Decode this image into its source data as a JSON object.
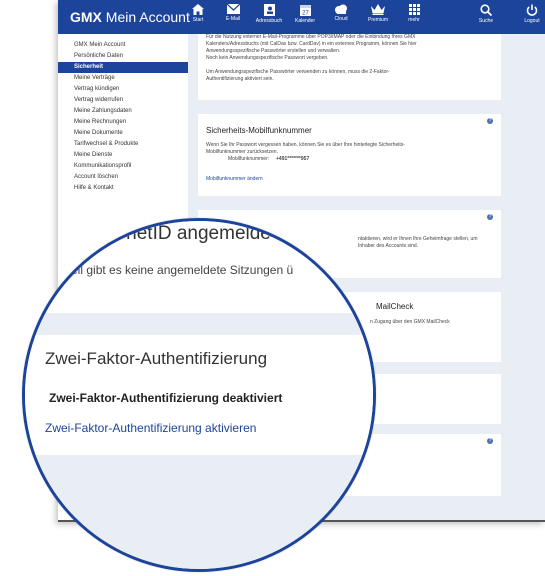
{
  "header": {
    "logo_brand": "GMX",
    "logo_title": "Mein Account",
    "nav": [
      {
        "label": "Start",
        "icon": "home-icon"
      },
      {
        "label": "E-Mail",
        "icon": "mail-icon"
      },
      {
        "label": "Adressbuch",
        "icon": "address-book-icon"
      },
      {
        "label": "Kalender",
        "icon": "calendar-icon"
      },
      {
        "label": "Cloud",
        "icon": "cloud-icon"
      },
      {
        "label": "Premium",
        "icon": "crown-icon"
      },
      {
        "label": "mehr",
        "icon": "grid-icon"
      },
      {
        "label": "Suche",
        "icon": "search-icon"
      },
      {
        "label": "Logout",
        "icon": "power-icon"
      }
    ]
  },
  "sidebar": {
    "items": [
      {
        "label": "GMX Mein Account"
      },
      {
        "label": "Persönliche Daten"
      },
      {
        "label": "Sicherheit"
      },
      {
        "label": "Meine Verträge"
      },
      {
        "label": "Vertrag kündigen"
      },
      {
        "label": "Vertrag widerrufen"
      },
      {
        "label": "Meine Zahlungsdaten"
      },
      {
        "label": "Meine Rechnungen"
      },
      {
        "label": "Meine Dokumente"
      },
      {
        "label": "Tarifwechsel & Produkte"
      },
      {
        "label": "Meine Dienste"
      },
      {
        "label": "Kommunikationsprofil"
      },
      {
        "label": "Account löschen"
      },
      {
        "label": "Hilfe & Kontakt"
      }
    ],
    "active_index": 2
  },
  "cards": {
    "app_passwords": {
      "line1": "Für die Nutzung externer E-Mail-Programme über POP3/IMAP oder die Einbindung Ihres GMX",
      "line2": "Kalenders/Adressbuchs (mit CalDav bzw. CardDav) in ein externes Programm, können Sie hier",
      "line3": "Anwendungsspezifische Passwörter erstellen und verwalten.",
      "line4": "Noch kein Anwendungsspezifische Passwort vergeben.",
      "line5": "Um Anwendungsspezifische Passwörter verwenden zu können, muss die 2-Faktor-",
      "line6": "Authentifizierung aktiviert sein."
    },
    "mobile": {
      "title": "Sicherheits-Mobilfunknummer",
      "line1": "Wenn Sie Ihr Passwort vergessen haben, können Sie es über Ihre hinterlegte Sicherheits-",
      "line2": "Mobilfunknummer zurücksetzen.",
      "number_label": "Mobilfunknummer:",
      "number_value": "+491*******957",
      "link": "Mobilfunknummer ändern"
    },
    "secret_question": {
      "line1": "ntaktieren, wird er Ihnen Ihre Geheimfrage stellen, um",
      "line2": "Inhaber des Accounts sind."
    },
    "mailcheck": {
      "title": "MailCheck",
      "line1": "n Zugang über den GMX MailCheck"
    }
  },
  "magnifier": {
    "netid_title": "t mit netID angemelde",
    "netid_sub": "ktuell gibt es keine angemeldete Sitzungen ü",
    "tfa_heading": "Zwei-Faktor-Authentifizierung",
    "tfa_status": "Zwei-Faktor-Authentifizierung deaktiviert",
    "tfa_link": "Zwei-Faktor-Authentifizierung aktivieren"
  },
  "colors": {
    "brand_blue": "#1c449b",
    "content_bg": "#e9eef4"
  }
}
